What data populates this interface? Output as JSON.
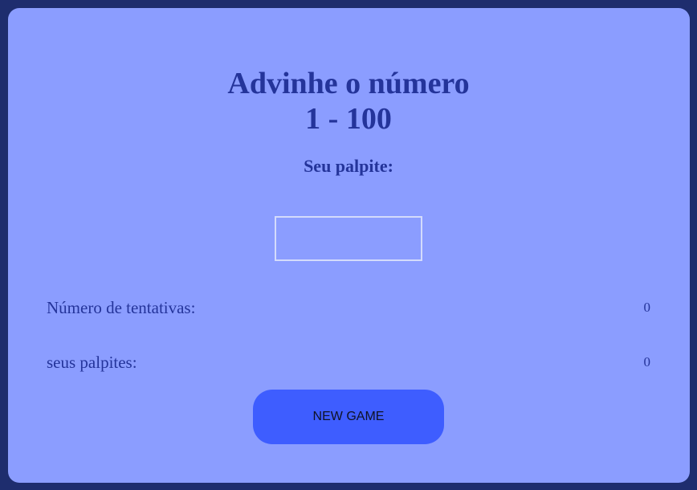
{
  "game": {
    "title_line1": "Advinhe o número",
    "title_line2": "1 - 100",
    "prompt": "Seu palpite:",
    "guess_value": "",
    "attempts_label": "Número de tentativas:",
    "attempts_value": "0",
    "guesses_label": "seus palpites:",
    "guesses_value": "0",
    "new_game_label": "NEW GAME"
  },
  "colors": {
    "page_background": "#1e2d6e",
    "card_background": "#8b9dff",
    "text": "#24349a",
    "button": "#3e5dff",
    "input_border": "#d4dbfb"
  }
}
